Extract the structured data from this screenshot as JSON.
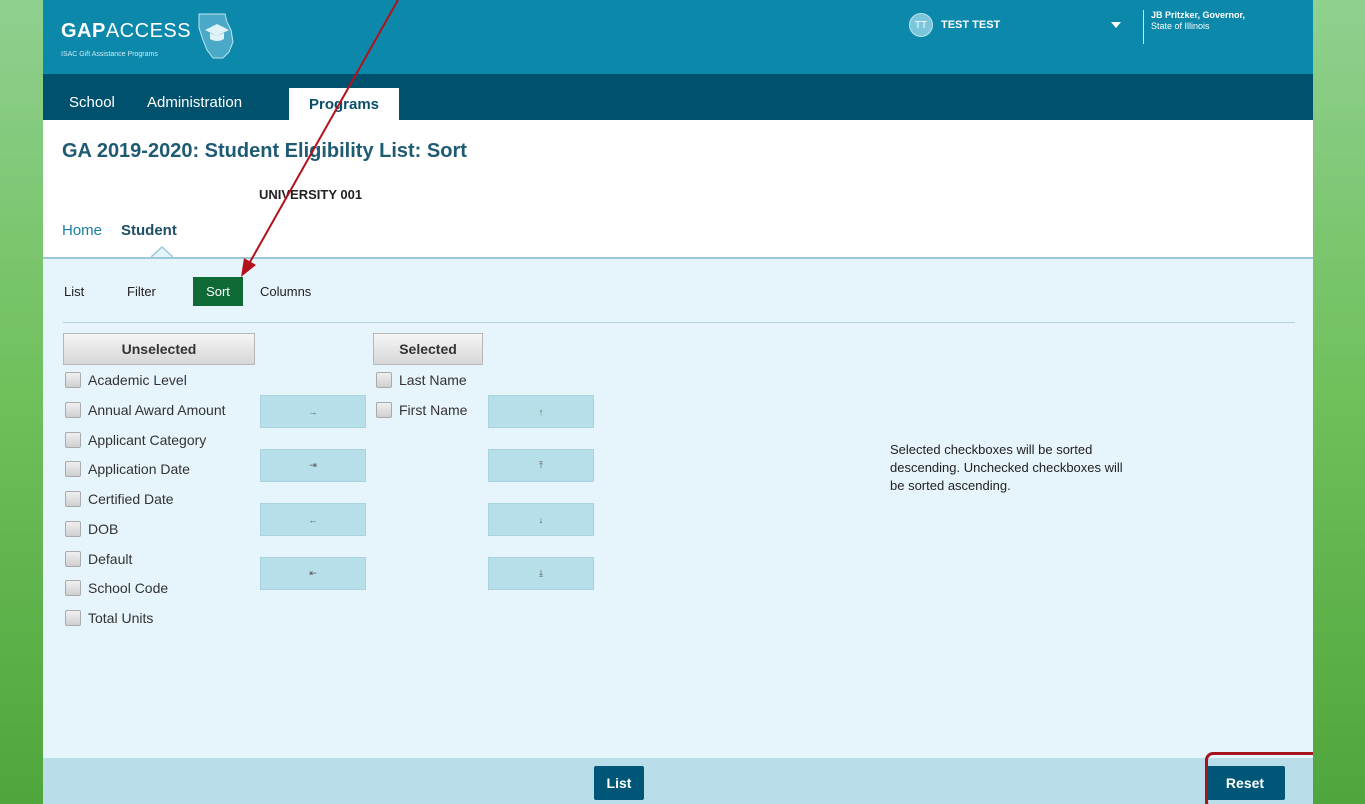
{
  "header": {
    "logo_bold": "GAP",
    "logo_light": "ACCESS",
    "logo_tagline": "ISAC Gift Assistance Programs",
    "user_initials": "TT",
    "user_name": "TEST TEST",
    "governor_line1": "JB Pritzker, Governor,",
    "governor_line2": "State of Illinois"
  },
  "nav": {
    "tabs": [
      "School",
      "Administration",
      "Programs"
    ],
    "active": "Programs"
  },
  "page": {
    "title": "GA 2019-2020: Student Eligibility List: Sort",
    "school": "UNIVERSITY 001",
    "subnav": [
      "Home",
      "Student"
    ]
  },
  "tabs": {
    "items": [
      "List",
      "Filter",
      "Sort",
      "Columns"
    ],
    "active": "Sort"
  },
  "unselected": {
    "header": "Unselected",
    "items": [
      "Academic Level",
      "Annual Award Amount",
      "Applicant Category",
      "Application Date",
      "Certified Date",
      "DOB",
      "Default",
      "School Code",
      "Total Units"
    ]
  },
  "selected": {
    "header": "Selected",
    "items": [
      "Last Name",
      "First Name"
    ]
  },
  "move_buttons": {
    "move_right": "→",
    "move_all_right": "⇥",
    "move_left": "←",
    "move_all_left": "⇤"
  },
  "order_buttons": {
    "move_up": "↑",
    "move_top": "⤒",
    "move_down": "↓",
    "move_bottom": "⤓"
  },
  "note": "Selected checkboxes will be sorted descending. Unchecked checkboxes will be sorted ascending.",
  "footer": {
    "list_label": "List",
    "reset_label": "Reset"
  },
  "colors": {
    "header_bg": "#0b88aa",
    "nav_bg": "#00516d",
    "active_tab": "#0e6b36",
    "footer_button": "#005677",
    "annotation": "#a5141c"
  }
}
